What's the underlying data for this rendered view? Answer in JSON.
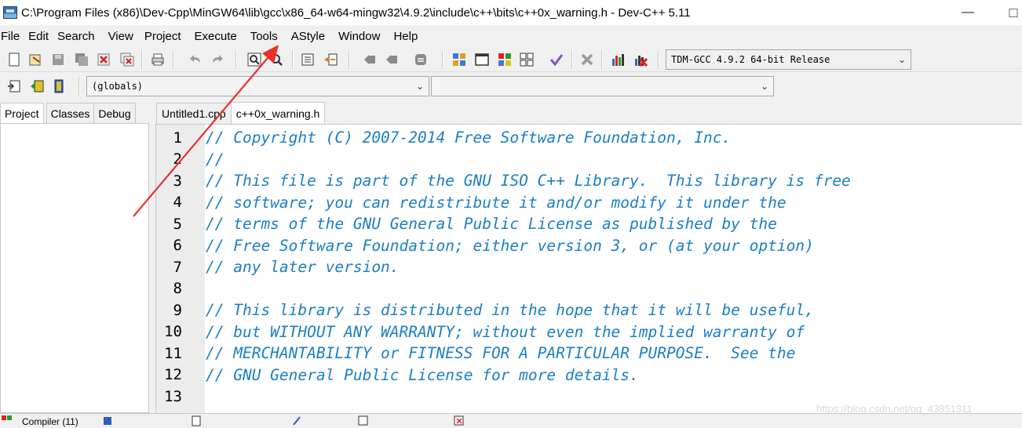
{
  "window": {
    "title": "C:\\Program Files (x86)\\Dev-Cpp\\MinGW64\\lib\\gcc\\x86_64-w64-mingw32\\4.9.2\\include\\c++\\bits\\c++0x_warning.h - Dev-C++ 5.11",
    "minimize_glyph": "—",
    "maximize_glyph": "□"
  },
  "menu": [
    "File",
    "Edit",
    "Search",
    "View",
    "Project",
    "Execute",
    "Tools",
    "AStyle",
    "Window",
    "Help"
  ],
  "toolbar": {
    "compiler_select": "TDM-GCC 4.9.2 64-bit Release",
    "icons": [
      "new-file-icon",
      "open-icon",
      "save-icon",
      "save-all-icon",
      "close-icon",
      "close-all-icon",
      "print-icon",
      "undo-icon",
      "redo-icon",
      "find-icon",
      "replace-icon",
      "indent-icon",
      "unindent-icon",
      "goto-back-icon",
      "goto-forward-icon",
      "toggle-comment-icon",
      "compile-icon",
      "run-icon",
      "compile-run-icon",
      "rebuild-icon",
      "syntax-check-icon",
      "stop-icon",
      "profile-icon",
      "delete-profile-icon"
    ]
  },
  "toolbar2": {
    "scope_select": "(globals)",
    "member_select": ""
  },
  "left_tabs": [
    "Project",
    "Classes",
    "Debug"
  ],
  "editor_tabs": [
    "Untitled1.cpp",
    "c++0x_warning.h"
  ],
  "active_editor_tab": 1,
  "code_lines": [
    {
      "n": "1",
      "text": "// Copyright (C) 2007-2014 Free Software Foundation, Inc."
    },
    {
      "n": "2",
      "text": "//"
    },
    {
      "n": "3",
      "text": "// This file is part of the GNU ISO C++ Library.  This library is free"
    },
    {
      "n": "4",
      "text": "// software; you can redistribute it and/or modify it under the"
    },
    {
      "n": "5",
      "text": "// terms of the GNU General Public License as published by the"
    },
    {
      "n": "6",
      "text": "// Free Software Foundation; either version 3, or (at your option)"
    },
    {
      "n": "7",
      "text": "// any later version."
    },
    {
      "n": "8",
      "text": ""
    },
    {
      "n": "9",
      "text": "// This library is distributed in the hope that it will be useful,"
    },
    {
      "n": "10",
      "text": "// but WITHOUT ANY WARRANTY; without even the implied warranty of"
    },
    {
      "n": "11",
      "text": "// MERCHANTABILITY or FITNESS FOR A PARTICULAR PURPOSE.  See the"
    },
    {
      "n": "12",
      "text": "// GNU General Public License for more details."
    },
    {
      "n": "13",
      "text": ""
    }
  ],
  "bottom_tabs": {
    "compiler_label": "Compiler (11)"
  },
  "watermark": "https://blog.csdn.net/qq_43851311",
  "colors": {
    "comment": "#1a7fc4",
    "annotation_arrow": "#e8322a",
    "gutter": "#ececec"
  }
}
